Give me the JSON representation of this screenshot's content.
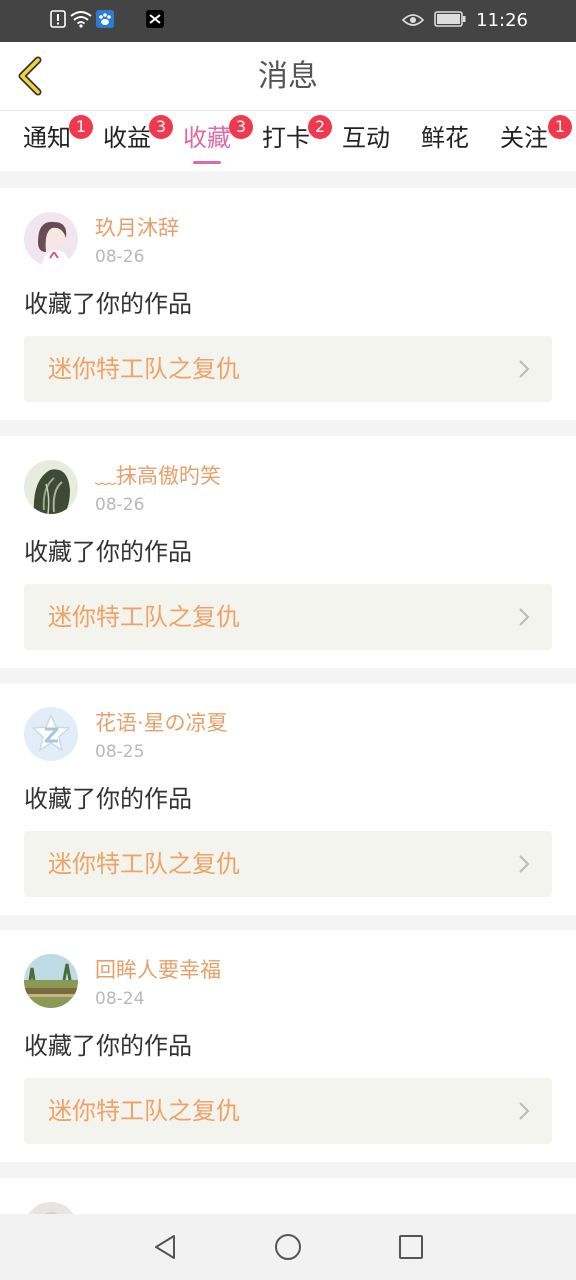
{
  "status_bar": {
    "time": "11:26",
    "left_icons": [
      "alert-icon",
      "wifi-icon",
      "baidu-icon",
      "capcut-icon"
    ],
    "right_icons": [
      "eye-icon",
      "battery-icon"
    ]
  },
  "header": {
    "title": "消息",
    "back_icon": "chevron-left-icon"
  },
  "tabs": [
    {
      "label": "通知",
      "badge": "1",
      "active": false
    },
    {
      "label": "收益",
      "badge": "3",
      "active": false
    },
    {
      "label": "收藏",
      "badge": "3",
      "active": true
    },
    {
      "label": "打卡",
      "badge": "2",
      "active": false
    },
    {
      "label": "互动",
      "badge": "",
      "active": false
    },
    {
      "label": "鲜花",
      "badge": "",
      "active": false
    },
    {
      "label": "关注",
      "badge": "1",
      "active": false
    }
  ],
  "messages": [
    {
      "username": "玖月沐辞",
      "date": "08-26",
      "action": "收藏了你的作品",
      "work": "迷你特工队之复仇"
    },
    {
      "username": "﹏抹高傲旳笑",
      "date": "08-26",
      "action": "收藏了你的作品",
      "work": "迷你特工队之复仇"
    },
    {
      "username": "花语·星の凉夏",
      "date": "08-25",
      "action": "收藏了你的作品",
      "work": "迷你特工队之复仇"
    },
    {
      "username": "回眸人要幸福",
      "date": "08-24",
      "action": "收藏了你的作品",
      "work": "迷你特工队之复仇"
    }
  ],
  "nav_bar": {
    "back": "triangle-back-icon",
    "home": "circle-home-icon",
    "recents": "square-recents-icon"
  },
  "colors": {
    "accent": "#e06aa3",
    "username": "#e7a06b",
    "work_title": "#eea266",
    "badge": "#f0394d"
  }
}
